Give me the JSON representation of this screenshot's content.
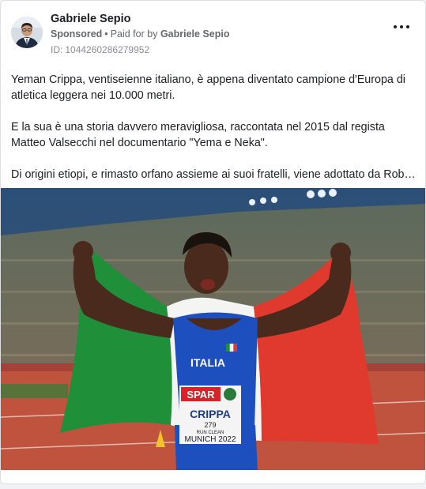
{
  "post": {
    "author_name": "Gabriele Sepio",
    "sponsored_label": "Sponsored",
    "separator": "•",
    "paid_for_prefix": "Paid for by",
    "paid_for_name": "Gabriele Sepio",
    "id_label": "ID:",
    "id_value": "1044260286279952",
    "more_icon": "more-options-icon",
    "paragraphs": [
      "Yeman Crippa, ventiseienne italiano, è appena diventato campione d'Europa di atletica leggera nei 10.000 metri.",
      "E la sua è una storia davvero meravigliosa, raccontata nel 2015 dal regista Matteo Valsecchi nel documentario \"Yema e Neka\".",
      "Di origini etiopi, e rimasto orfano assieme ai suoi fratelli, viene adottato da Roberto Crippa"
    ]
  },
  "photo": {
    "bib_sponsor": "SPAR",
    "bib_name": "CRIPPA",
    "bib_number": "279",
    "bib_tagline": "RUN CLEAN",
    "bib_event": "MUNICH 2022",
    "shirt_text": "ITALIA",
    "colors": {
      "flag_green": "#1f8f3a",
      "flag_white": "#f4f4f2",
      "flag_red": "#e03a2f",
      "singlet_blue": "#1d4fbf",
      "track_red": "#c0533d"
    }
  }
}
